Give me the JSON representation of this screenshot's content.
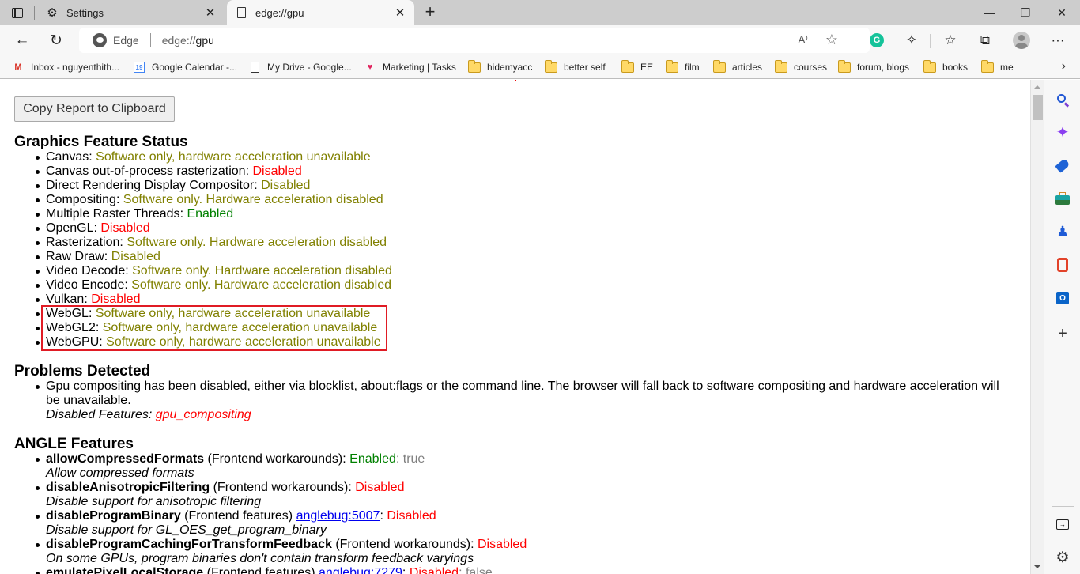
{
  "tabs": [
    {
      "title": "Settings",
      "icon": "gear-icon",
      "active": false
    },
    {
      "title": "edge://gpu",
      "icon": "page-icon",
      "active": true
    }
  ],
  "window": {
    "minimize": "—",
    "restore": "❐",
    "close": "✕"
  },
  "toolbar": {
    "back": "←",
    "refresh": "↻",
    "site_label": "Edge",
    "url_prefix": "edge://",
    "url_host": "gpu",
    "read_aloud": "A⁾",
    "more": "···"
  },
  "bookmarks": [
    {
      "label": "Inbox - nguyenthith...",
      "icon": "gmail-icon"
    },
    {
      "label": "Google Calendar -...",
      "icon": "calendar-icon"
    },
    {
      "label": "My Drive - Google...",
      "icon": "page-icon"
    },
    {
      "label": "Marketing | Tasks",
      "icon": "heart-icon"
    },
    {
      "label": "hidemyacc",
      "icon": "folder-icon"
    },
    {
      "label": "better self",
      "icon": "folder-icon"
    },
    {
      "label": "EE",
      "icon": "folder-icon"
    },
    {
      "label": "film",
      "icon": "folder-icon"
    },
    {
      "label": "articles",
      "icon": "folder-icon"
    },
    {
      "label": "courses",
      "icon": "folder-icon"
    },
    {
      "label": "forum, blogs",
      "icon": "folder-icon"
    },
    {
      "label": "books",
      "icon": "folder-icon"
    },
    {
      "label": "me",
      "icon": "folder-icon"
    }
  ],
  "page": {
    "copy_button": "Copy Report to Clipboard",
    "graphics_heading": "Graphics Feature Status",
    "features": [
      {
        "name": "Canvas",
        "status": "Software only, hardware acceleration unavailable",
        "color": "olive"
      },
      {
        "name": "Canvas out-of-process rasterization",
        "status": "Disabled",
        "color": "red"
      },
      {
        "name": "Direct Rendering Display Compositor",
        "status": "Disabled",
        "color": "olive"
      },
      {
        "name": "Compositing",
        "status": "Software only. Hardware acceleration disabled",
        "color": "olive"
      },
      {
        "name": "Multiple Raster Threads",
        "status": "Enabled",
        "color": "green"
      },
      {
        "name": "OpenGL",
        "status": "Disabled",
        "color": "red"
      },
      {
        "name": "Rasterization",
        "status": "Software only. Hardware acceleration disabled",
        "color": "olive"
      },
      {
        "name": "Raw Draw",
        "status": "Disabled",
        "color": "olive"
      },
      {
        "name": "Video Decode",
        "status": "Software only. Hardware acceleration disabled",
        "color": "olive"
      },
      {
        "name": "Video Encode",
        "status": "Software only. Hardware acceleration disabled",
        "color": "olive"
      },
      {
        "name": "Vulkan",
        "status": "Disabled",
        "color": "red"
      },
      {
        "name": "WebGL",
        "status": "Software only, hardware acceleration unavailable",
        "color": "olive"
      },
      {
        "name": "WebGL2",
        "status": "Software only, hardware acceleration unavailable",
        "color": "olive"
      },
      {
        "name": "WebGPU",
        "status": "Software only, hardware acceleration unavailable",
        "color": "olive"
      }
    ],
    "problems_heading": "Problems Detected",
    "problem_text": "Gpu compositing has been disabled, either via blocklist, about:flags or the command line. The browser will fall back to software compositing and hardware acceleration will be unavailable.",
    "problem_disabled_label": "Disabled Features: ",
    "problem_disabled_value": "gpu_compositing",
    "angle_heading": "ANGLE Features",
    "angle_features": [
      {
        "name": "allowCompressedFormats",
        "category": " (Frontend workarounds)",
        "bug": "",
        "status": "Enabled",
        "status_color": "green",
        "extra": ": true",
        "desc": "Allow compressed formats"
      },
      {
        "name": "disableAnisotropicFiltering",
        "category": " (Frontend workarounds)",
        "bug": "",
        "status": "Disabled",
        "status_color": "red",
        "extra": "",
        "desc": "Disable support for anisotropic filtering"
      },
      {
        "name": "disableProgramBinary",
        "category": " (Frontend features) ",
        "bug": "anglebug:5007",
        "status": "Disabled",
        "status_color": "red",
        "extra": "",
        "desc": "Disable support for GL_OES_get_program_binary"
      },
      {
        "name": "disableProgramCachingForTransformFeedback",
        "category": " (Frontend workarounds)",
        "bug": "",
        "status": "Disabled",
        "status_color": "red",
        "extra": "",
        "desc": "On some GPUs, program binaries don't contain transform feedback varyings"
      },
      {
        "name": "emulatePixelLocalStorage",
        "category": " (Frontend features) ",
        "bug": "anglebug:7279",
        "status": "Disabled",
        "status_color": "red",
        "extra": ": false",
        "desc": ""
      }
    ]
  },
  "colors": {
    "olive": "#808000",
    "red": "#ff0000",
    "green": "#008000",
    "highlight": "#e01b24"
  }
}
